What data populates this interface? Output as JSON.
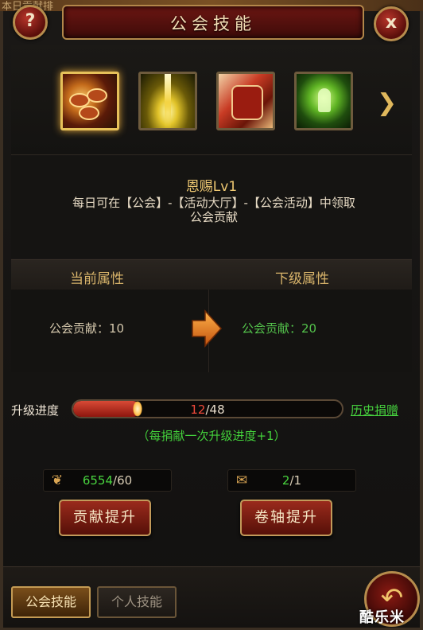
{
  "background_text": "本日贡献排",
  "header": {
    "title": "公会技能",
    "help_label": "?",
    "close_label": "x"
  },
  "skills": [
    {
      "icon": "coins-bowl-icon",
      "selected": true
    },
    {
      "icon": "light-beam-icon",
      "selected": false
    },
    {
      "icon": "scroll-icon",
      "selected": false
    },
    {
      "icon": "green-aura-icon",
      "selected": false
    }
  ],
  "selected_skill": {
    "name": "恩赐Lv1",
    "description": "每日可在【公会】-【活动大厅】-【公会活动】中领取公会贡献"
  },
  "attributes": {
    "current_header": "当前属性",
    "next_header": "下级属性",
    "current_value": "公会贡献：10",
    "next_value": "公会贡献：20"
  },
  "progress": {
    "label": "升级进度",
    "current": "12",
    "total": "/48",
    "fraction": 0.25,
    "history_link": "历史捐赠",
    "hint": "（每捐献一次升级进度+1）"
  },
  "resources": {
    "contribution": {
      "icon": "pouch-icon",
      "current": "6554",
      "required": "/60"
    },
    "scroll": {
      "icon": "scroll-item-icon",
      "current": "2",
      "required": "/1"
    }
  },
  "buttons": {
    "contribute": "贡献提升",
    "scroll": "卷轴提升"
  },
  "tabs": {
    "guild": "公会技能",
    "personal": "个人技能"
  },
  "watermark": "酷乐米",
  "colors": {
    "accent_gold": "#e7c15a",
    "positive_green": "#49d43f",
    "progress_red": "#f24a3a"
  }
}
